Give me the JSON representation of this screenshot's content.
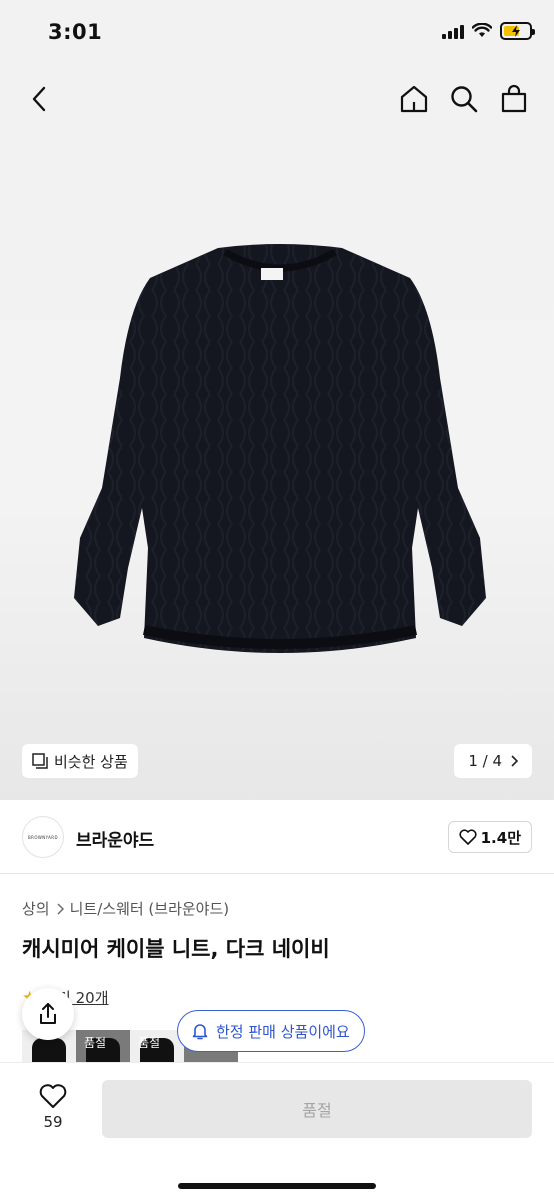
{
  "status": {
    "time": "3:01"
  },
  "nav": {
    "back_icon": "chevron-left-icon",
    "home_icon": "home-icon",
    "search_icon": "search-icon",
    "bag_icon": "shopping-bag-icon"
  },
  "gallery": {
    "similar_label": "비슷한 상품",
    "page_indicator": "1 / 4"
  },
  "brand": {
    "logo_text": "BROWNYARD",
    "name": "브라운야드",
    "likes": "1.4만"
  },
  "product": {
    "breadcrumb": [
      "상의",
      "니트/스웨터 (브라운야드)"
    ],
    "title": "캐시미어 케이블 니트, 다크 네이비",
    "review_label": "후기 20개",
    "thumbnails": [
      {
        "style": "light",
        "label": ""
      },
      {
        "style": "dark",
        "label": "품절"
      },
      {
        "style": "light",
        "label": "품절"
      },
      {
        "style": "dark",
        "label": "품절"
      }
    ]
  },
  "floating": {
    "limited_label": "한정 판매 상품이에요"
  },
  "bottom": {
    "like_count": "59",
    "cta_label": "품절"
  },
  "colors": {
    "accent_blue": "#2f55cf",
    "sweater": "#14171f",
    "disabled_bg": "#e7e7e7",
    "disabled_text": "#a5a5a5"
  }
}
